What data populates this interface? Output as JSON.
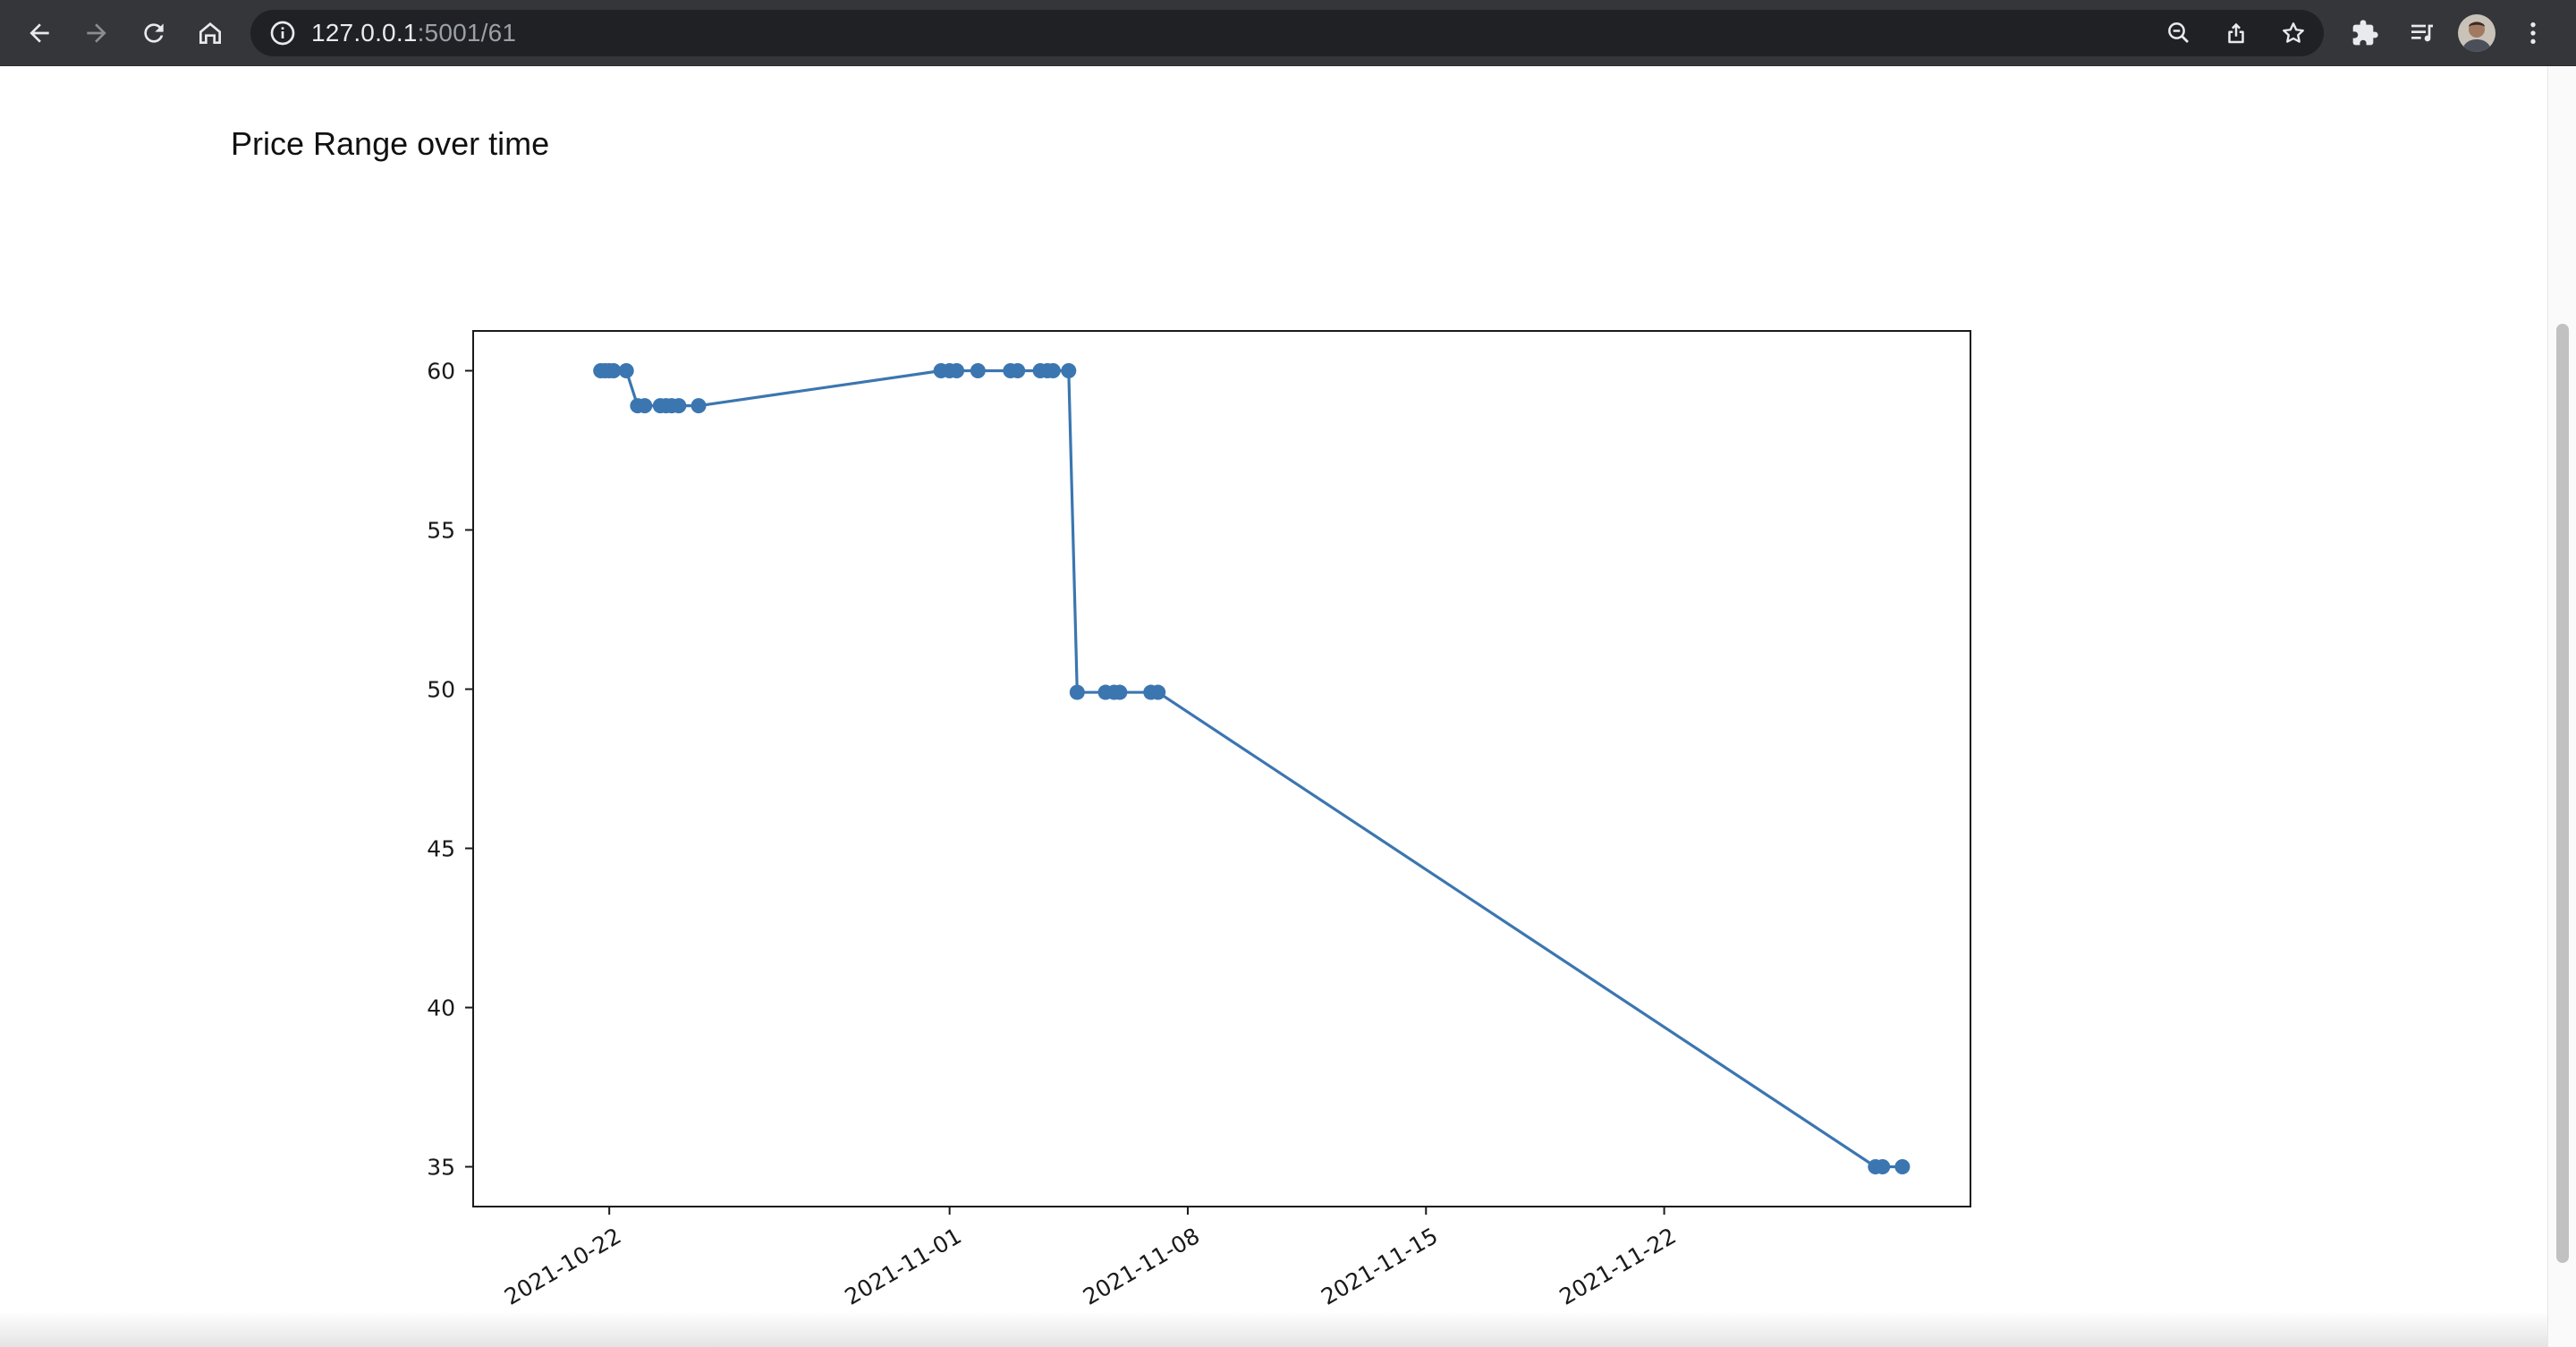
{
  "browser": {
    "url_host": "127.0.0.1",
    "url_rest": ":5001/61",
    "icons": [
      "back-icon",
      "forward-icon",
      "reload-icon",
      "home-icon",
      "info-icon",
      "zoom-out-icon",
      "share-icon",
      "star-icon",
      "extensions-icon",
      "reading-list-icon",
      "avatar",
      "menu-icon"
    ]
  },
  "page": {
    "title": "Price Range over time"
  },
  "chart_data": {
    "type": "line",
    "title": "",
    "xlabel": "",
    "ylabel": "",
    "x_type": "date",
    "xlim": [
      "2021-10-18",
      "2021-12-01"
    ],
    "ylim": [
      33.75,
      61.25
    ],
    "grid": false,
    "color": "#3b76b0",
    "marker": "circle",
    "x_ticks": [
      "2021-10-22",
      "2021-11-01",
      "2021-11-08",
      "2021-11-15",
      "2021-11-22"
    ],
    "y_ticks": [
      35,
      40,
      45,
      50,
      55,
      60
    ],
    "series": [
      {
        "name": "",
        "points": [
          {
            "x": "2021-10-21 18:00",
            "y": 60
          },
          {
            "x": "2021-10-21 21:00",
            "y": 60
          },
          {
            "x": "2021-10-22 00:00",
            "y": 60
          },
          {
            "x": "2021-10-22 03:00",
            "y": 60
          },
          {
            "x": "2021-10-22 12:00",
            "y": 60
          },
          {
            "x": "2021-10-22 20:00",
            "y": 58.9
          },
          {
            "x": "2021-10-23 01:00",
            "y": 58.9
          },
          {
            "x": "2021-10-23 12:00",
            "y": 58.9
          },
          {
            "x": "2021-10-23 16:00",
            "y": 58.9
          },
          {
            "x": "2021-10-23 20:00",
            "y": 58.9
          },
          {
            "x": "2021-10-24 01:00",
            "y": 58.9
          },
          {
            "x": "2021-10-24 15:00",
            "y": 58.9
          },
          {
            "x": "2021-10-31 18:00",
            "y": 60
          },
          {
            "x": "2021-11-01 00:00",
            "y": 60
          },
          {
            "x": "2021-11-01 05:00",
            "y": 60
          },
          {
            "x": "2021-11-01 20:00",
            "y": 60
          },
          {
            "x": "2021-11-02 19:00",
            "y": 60
          },
          {
            "x": "2021-11-03 00:00",
            "y": 60
          },
          {
            "x": "2021-11-03 16:00",
            "y": 60
          },
          {
            "x": "2021-11-03 21:00",
            "y": 60
          },
          {
            "x": "2021-11-04 01:00",
            "y": 60
          },
          {
            "x": "2021-11-04 12:00",
            "y": 60
          },
          {
            "x": "2021-11-04 18:00",
            "y": 49.9
          },
          {
            "x": "2021-11-05 14:00",
            "y": 49.9
          },
          {
            "x": "2021-11-05 20:00",
            "y": 49.9
          },
          {
            "x": "2021-11-06 00:00",
            "y": 49.9
          },
          {
            "x": "2021-11-06 22:00",
            "y": 49.9
          },
          {
            "x": "2021-11-07 03:00",
            "y": 49.9
          },
          {
            "x": "2021-11-28 05:00",
            "y": 35
          },
          {
            "x": "2021-11-28 10:00",
            "y": 35
          },
          {
            "x": "2021-11-29 00:00",
            "y": 35
          }
        ]
      }
    ]
  }
}
